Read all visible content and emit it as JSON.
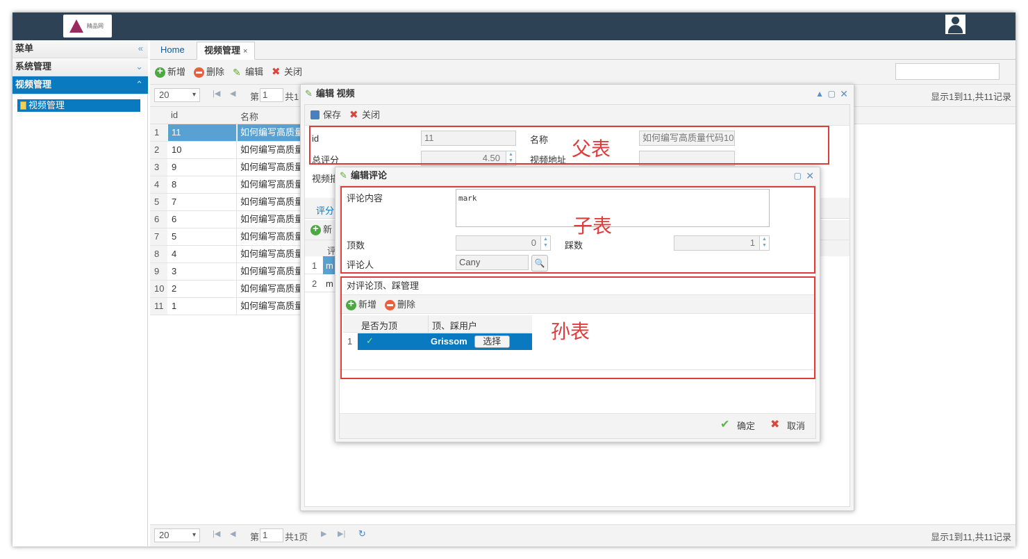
{
  "app": {
    "logo_text": "精品网"
  },
  "sidebar": {
    "menu_title": "菜单",
    "groups": [
      {
        "label": "系统管理"
      },
      {
        "label": "视频管理"
      }
    ],
    "items": [
      {
        "label": "视频管理"
      }
    ]
  },
  "tabs": [
    {
      "label": "Home"
    },
    {
      "label": "视频管理"
    }
  ],
  "toolbar": {
    "add": "新增",
    "delete": "删除",
    "edit": "编辑",
    "close": "关闭"
  },
  "pager_top": {
    "size": "20",
    "page_label": "第",
    "page": "1",
    "total_prefix": "共1",
    "info": "显示1到11,共11记录"
  },
  "pager_bottom": {
    "size": "20",
    "page_label": "第",
    "page": "1",
    "total": "共1页",
    "info": "显示1到11,共11记录"
  },
  "grid": {
    "columns": [
      "id",
      "名称"
    ],
    "rows": [
      {
        "rn": "1",
        "id": "11",
        "name": "如何编写高质量代码"
      },
      {
        "rn": "2",
        "id": "10",
        "name": "如何编写高质量代码"
      },
      {
        "rn": "3",
        "id": "9",
        "name": "如何编写高质量代码"
      },
      {
        "rn": "4",
        "id": "8",
        "name": "如何编写高质量代码"
      },
      {
        "rn": "5",
        "id": "7",
        "name": "如何编写高质量代码"
      },
      {
        "rn": "6",
        "id": "6",
        "name": "如何编写高质量代码"
      },
      {
        "rn": "7",
        "id": "5",
        "name": "如何编写高质量代码"
      },
      {
        "rn": "8",
        "id": "4",
        "name": "如何编写高质量代码"
      },
      {
        "rn": "9",
        "id": "3",
        "name": "如何编写高质量代码"
      },
      {
        "rn": "10",
        "id": "2",
        "name": "如何编写高质量代码"
      },
      {
        "rn": "11",
        "id": "1",
        "name": "如何编写高质量代码"
      }
    ]
  },
  "dialog_video": {
    "title": "编辑 视频",
    "save": "保存",
    "close": "关闭",
    "id_label": "id",
    "id_value": "11",
    "name_label": "名称",
    "name_value": "如何编写高质量代码10",
    "score_label": "总评分",
    "score_value": "4.50",
    "url_label": "视频地址",
    "url_value": "",
    "desc_label": "视频描",
    "tab_label": "评分",
    "sub_add": "新",
    "sub_col": "评",
    "sub_rows": [
      {
        "rn": "1",
        "c": "m"
      },
      {
        "rn": "2",
        "c": "m"
      }
    ]
  },
  "dialog_comment": {
    "title": "编辑评论",
    "content_label": "评论内容",
    "content_value": "mark",
    "up_label": "顶数",
    "up_value": "0",
    "down_label": "踩数",
    "down_value": "1",
    "user_label": "评论人",
    "user_value": "Cany",
    "section_title": "对评论顶、踩管理",
    "add": "新增",
    "delete": "删除",
    "columns": [
      "是否为顶",
      "顶、踩用户"
    ],
    "rows": [
      {
        "rn": "1",
        "is_up": "✓",
        "user": "Grissom",
        "choose": "选择"
      }
    ],
    "ok": "确定",
    "cancel": "取消"
  },
  "annotations": {
    "parent": "父表",
    "child": "子表",
    "grandchild": "孙表"
  }
}
